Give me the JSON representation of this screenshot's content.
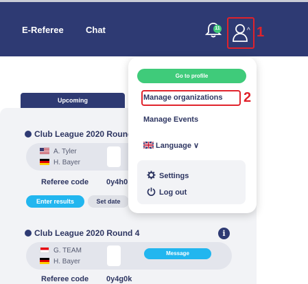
{
  "header": {
    "nav": [
      "E-Referee",
      "Chat"
    ],
    "notification_count": "11",
    "user_caret": "^"
  },
  "annotations": {
    "marker_1": "1",
    "marker_2": "2"
  },
  "tabs": {
    "upcoming": "Upcoming"
  },
  "matches": [
    {
      "title": "Club League 2020 Round",
      "players": [
        {
          "name": "A. Tyler",
          "flag": "us-flag-icon"
        },
        {
          "name": "H. Bayer",
          "flag": "de-flag-icon"
        }
      ],
      "referee_label": "Referee code",
      "referee_code": "0y4h0",
      "actions": [
        "Enter results",
        "Set date"
      ]
    },
    {
      "title": "Club League 2020 Round 4",
      "players": [
        {
          "name": "G. TEAM",
          "flag": "id-flag-icon"
        },
        {
          "name": "H. Bayer",
          "flag": "de-flag-icon"
        }
      ],
      "referee_label": "Referee code",
      "referee_code": "0y4g0k",
      "actions": [
        "Message"
      ],
      "info_icon": "i"
    }
  ],
  "dropdown": {
    "profile_button": "Go to profile",
    "items": [
      "Manage organizations",
      "Manage Events"
    ],
    "language_label": "Language",
    "language_caret": "∨",
    "settings": "Settings",
    "logout": "Log out"
  },
  "colors": {
    "header_bg": "#2e3a73",
    "accent_green": "#3fcb7a",
    "accent_blue": "#22b6ef",
    "annotation_red": "#e0222b"
  }
}
